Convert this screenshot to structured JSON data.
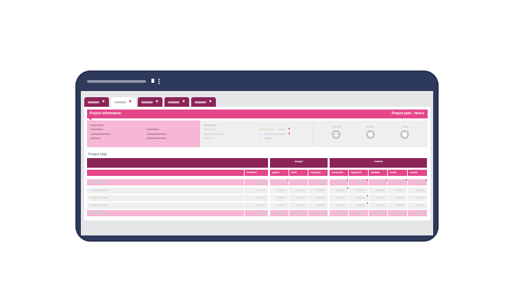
{
  "header": {
    "left_title": "Project information",
    "right_title": "Project pain - Hours"
  },
  "gauges": [
    {
      "label": "Step done",
      "value": "80%"
    },
    {
      "label": "left done",
      "value": ""
    },
    {
      "label": "context",
      "value": ""
    }
  ],
  "section": {
    "title": "Project total"
  },
  "table": {
    "group_budget": "budget",
    "group_realized": "realized",
    "col_first": "hrs/boars",
    "col_project": "project",
    "col_tasks": "tasks",
    "col_employee": "employee",
    "col_hourly_rate": "hourly rate",
    "col_registered": "registered",
    "col_estimate": "estimate",
    "col_actual1": "actual",
    "col_actual2": "context"
  },
  "colors": {
    "frame": "#2e3a5c",
    "brand_dark": "#8b2457",
    "brand": "#e5468a",
    "brand_light": "#f5b7d3"
  }
}
